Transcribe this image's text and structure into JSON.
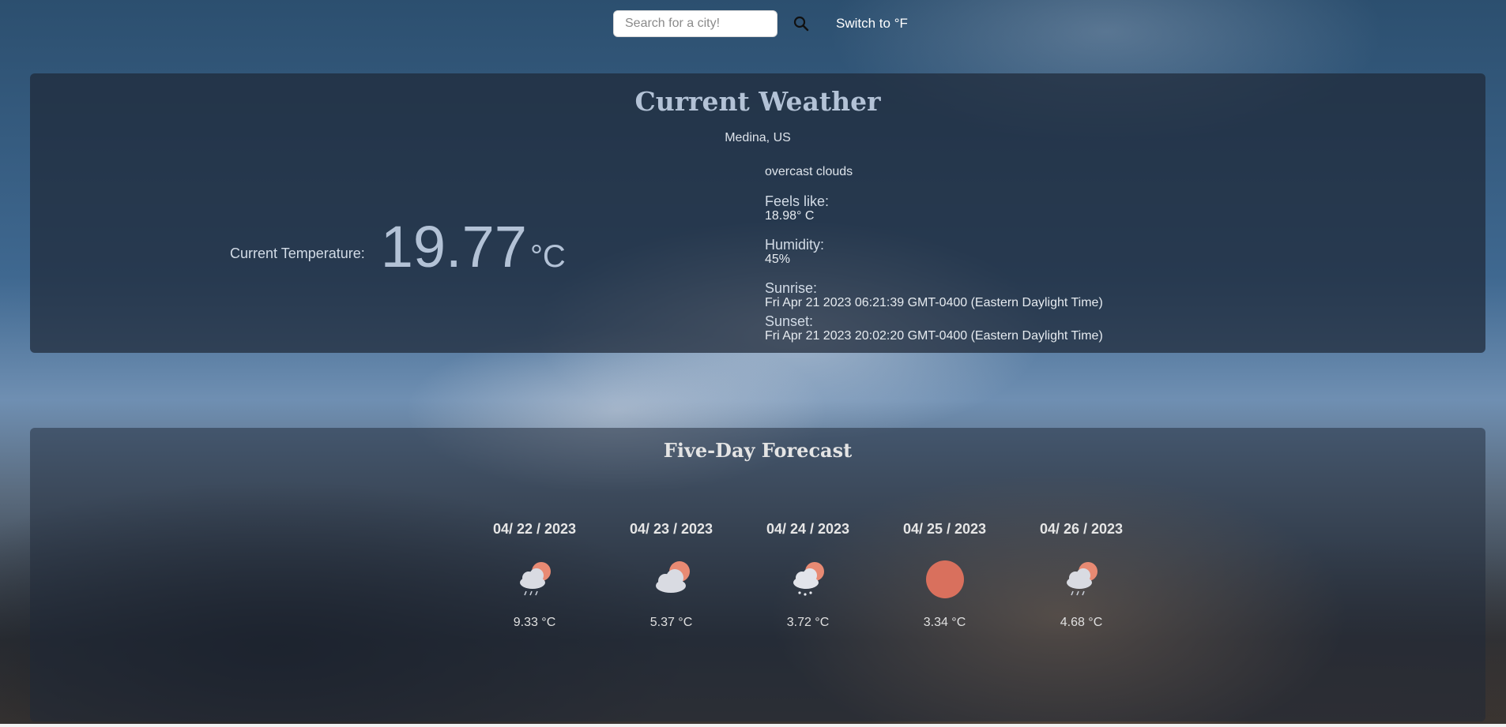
{
  "search": {
    "placeholder": "Search for a city!",
    "icon": "search-icon"
  },
  "unit_toggle_label": "Switch to °F",
  "current": {
    "title": "Current Weather",
    "location": "Medina, US",
    "temp_label": "Current Temperature:",
    "temp_value": "19.77",
    "temp_unit": "°C",
    "description": "overcast clouds",
    "feels_like_label": "Feels like:",
    "feels_like_value": "18.98° C",
    "humidity_label": "Humidity:",
    "humidity_value": "45%",
    "sunrise_label": "Sunrise:",
    "sunrise_value": "Fri Apr 21 2023 06:21:39 GMT-0400 (Eastern Daylight Time)",
    "sunset_label": "Sunset:",
    "sunset_value": "Fri Apr 21 2023 20:02:20 GMT-0400 (Eastern Daylight Time)"
  },
  "forecast": {
    "title": "Five-Day Forecast",
    "days": [
      {
        "date": "04/ 22 / 2023",
        "temp": "9.33 °C",
        "icon": "rain-cloud-sun-icon"
      },
      {
        "date": "04/ 23 / 2023",
        "temp": "5.37 °C",
        "icon": "cloud-sun-icon"
      },
      {
        "date": "04/ 24 / 2023",
        "temp": "3.72 °C",
        "icon": "snow-cloud-sun-icon"
      },
      {
        "date": "04/ 25 / 2023",
        "temp": "3.34 °C",
        "icon": "sun-icon"
      },
      {
        "date": "04/ 26 / 2023",
        "temp": "4.68 °C",
        "icon": "rain-cloud-sun-icon"
      }
    ]
  },
  "colors": {
    "title": "#b3c2d6",
    "sun": "#e88a73",
    "cloud": "#d9dbe2"
  }
}
